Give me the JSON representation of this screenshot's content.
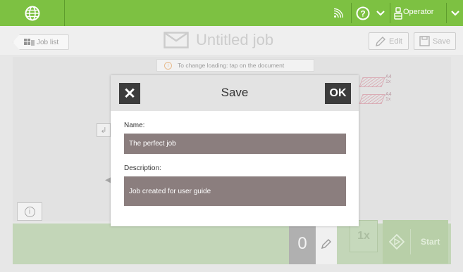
{
  "topbar": {
    "user_label": "Operator",
    "accent": "#7dc142"
  },
  "header": {
    "job_list_label": "Job list",
    "title": "Untitled job",
    "edit_label": "Edit",
    "save_label": "Save"
  },
  "notice": {
    "text": "To change loading: tap on the document"
  },
  "documents": [
    {
      "size": "A4",
      "count": "1x"
    },
    {
      "size": "A4",
      "count": "1x"
    }
  ],
  "bottom": {
    "counter": "0",
    "multiplier": "1x",
    "start_label": "Start"
  },
  "dialog": {
    "title": "Save",
    "ok_label": "OK",
    "name_label": "Name:",
    "name_value": "The perfect job",
    "description_label": "Description:",
    "description_value": "Job created for user guide"
  }
}
